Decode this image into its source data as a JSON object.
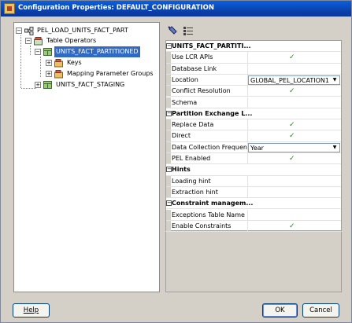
{
  "window": {
    "title": "Configuration Properties: DEFAULT_CONFIGURATION"
  },
  "tree": {
    "root": "PEL_LOAD_UNITS_FACT_PART",
    "table_operators": "Table Operators",
    "selected_table": "UNITS_FACT_PARTITIONED",
    "keys": "Keys",
    "mapping_parameter_groups": "Mapping Parameter Groups",
    "staging_table": "UNITS_FACT_STAGING"
  },
  "props": {
    "sec1": "UNITS_FACT_PARTITI...",
    "use_lcr_apis": "Use LCR APIs",
    "database_link": "Database Link",
    "location": "Location",
    "location_value": "GLOBAL_PEL_LOCATION1",
    "conflict_resolution": "Conflict Resolution",
    "schema": "Schema",
    "sec2": "Partition Exchange L...",
    "replace_data": "Replace Data",
    "direct": "Direct",
    "data_collection_frequency": "Data Collection Frequency",
    "frequency_value": "Year",
    "pel_enabled": "PEL Enabled",
    "sec3": "Hints",
    "loading_hint": "Loading hint",
    "extraction_hint": "Extraction hint",
    "sec4": "Constraint managem...",
    "exceptions_table_name": "Exceptions Table Name",
    "enable_constraints": "Enable Constraints",
    "check_glyph": "✓"
  },
  "buttons": {
    "help": "Help",
    "ok": "OK",
    "cancel": "Cancel"
  }
}
